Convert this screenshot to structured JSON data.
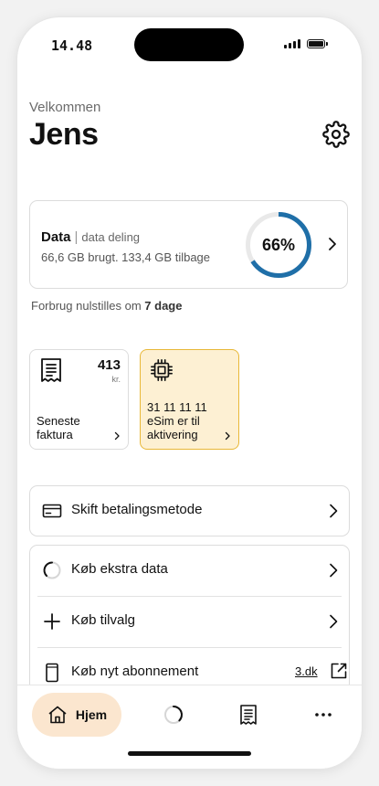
{
  "status_bar": {
    "time": "14.48"
  },
  "header": {
    "greeting": "Velkommen",
    "name": "Jens"
  },
  "data_card": {
    "title": "Data",
    "subtitle": "data deling",
    "usage": "66,6 GB brugt. 133,4 GB tilbage",
    "percent_label": "66%",
    "percent_value": 0.66,
    "accent_color": "#1f6fa8"
  },
  "reset_note": {
    "prefix": "Forbrug nulstilles om",
    "days": "7 dage"
  },
  "tiles": {
    "invoice": {
      "amount": "413",
      "unit": "kr.",
      "label": "Seneste faktura",
      "icon": "receipt-icon"
    },
    "esim": {
      "label": "31 11 11 11 eSim er til aktivering",
      "icon": "chip-icon"
    }
  },
  "payment": {
    "label": "Skift betalingsmetode",
    "icon": "credit-card-icon"
  },
  "buy_list": [
    {
      "label": "Køb ekstra data",
      "icon": "loading-circle-icon"
    },
    {
      "label": "Køb tilvalg",
      "icon": "plus-icon"
    },
    {
      "label": "Køb nyt abonnement",
      "icon": "phone-icon",
      "link": "3.dk"
    }
  ],
  "tab_bar": {
    "home_label": "Hjem",
    "home_color": "#fbe6cf",
    "tabs": [
      "home-icon",
      "usage-icon",
      "receipt-icon",
      "more-icon"
    ]
  }
}
